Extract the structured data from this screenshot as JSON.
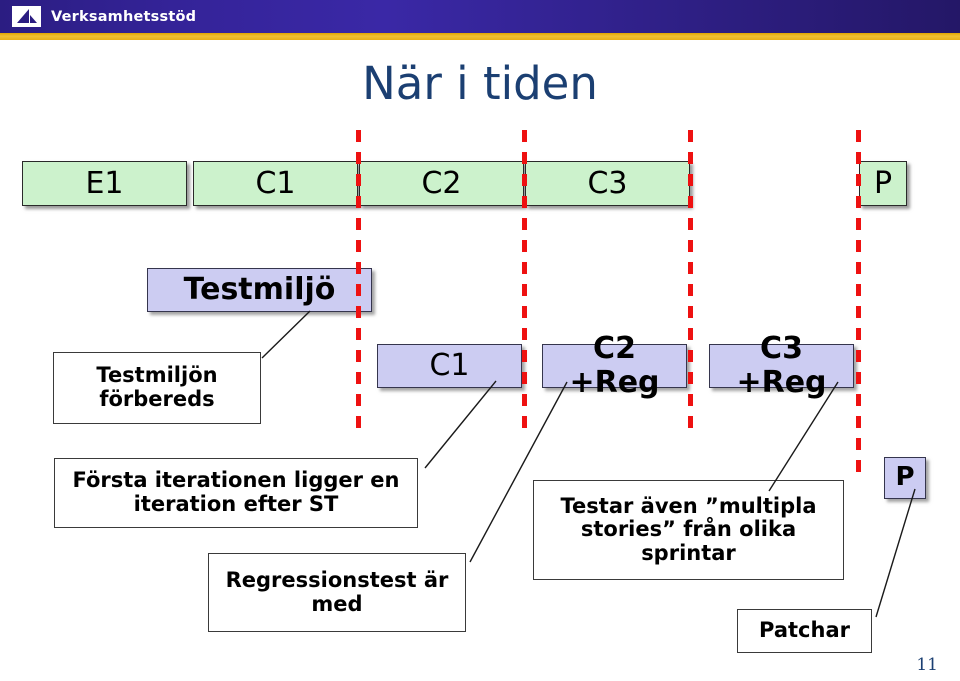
{
  "header": {
    "title": "Verksamhetsstöd",
    "logo_icon": "sail-logo-icon",
    "bar_color": "#2e1f8c",
    "accent_color": "#efbe2a"
  },
  "slide": {
    "title": "När i tiden",
    "title_color": "#1b3f72",
    "page_number": "11"
  },
  "timeline": {
    "sprints": [
      {
        "label": "E1"
      },
      {
        "label": "C1"
      },
      {
        "label": "C2"
      },
      {
        "label": "C3"
      },
      {
        "label": "P"
      }
    ],
    "sprint_fill": "#ccf2cc",
    "divider_color": "#ee1111"
  },
  "test_track": {
    "env_label": "Testmiljö",
    "items": [
      {
        "label": "C1"
      },
      {
        "label": "C2 +Reg"
      },
      {
        "label": "C3 +Reg"
      },
      {
        "label": "P"
      }
    ],
    "fill": "#ccccf2"
  },
  "notes": [
    {
      "id": "note-env",
      "text": "Testmiljön förbereds"
    },
    {
      "id": "note-first-iteration",
      "text": "Första iterationen ligger en iteration efter ST"
    },
    {
      "id": "note-regression",
      "text": "Regressionstest är med"
    },
    {
      "id": "note-multiple-stories",
      "text": "Testar även ”multipla stories” från olika sprintar"
    },
    {
      "id": "note-patch",
      "text": "Patchar"
    }
  ]
}
